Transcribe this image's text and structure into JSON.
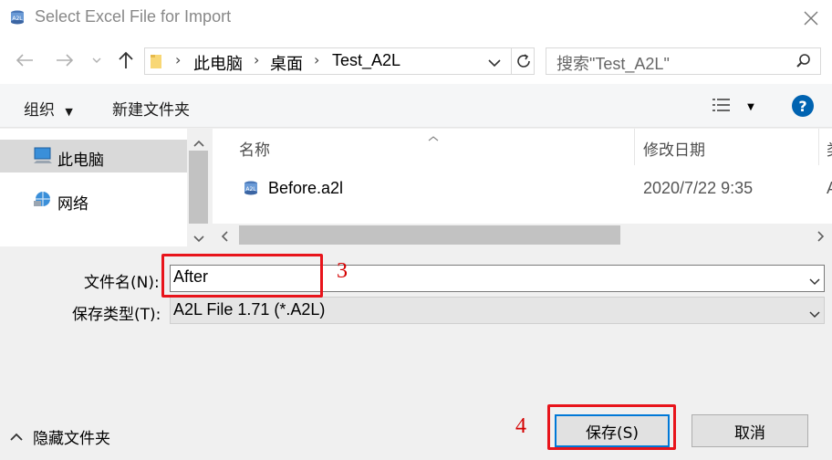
{
  "window": {
    "title": "Select Excel File for Import"
  },
  "address": {
    "crumbs": [
      "此电脑",
      "桌面",
      "Test_A2L"
    ],
    "search_placeholder": "搜索\"Test_A2L\""
  },
  "toolbar": {
    "organize": "组织",
    "new_folder": "新建文件夹"
  },
  "nav": {
    "items": [
      {
        "label": "此电脑"
      },
      {
        "label": "网络"
      }
    ]
  },
  "columns": {
    "name": "名称",
    "date": "修改日期",
    "extra": "类"
  },
  "files": [
    {
      "name": "Before.a2l",
      "date": "2020/7/22 9:35",
      "extra": "A"
    }
  ],
  "form": {
    "filename_label": "文件名(N):",
    "filename_value": "After",
    "filetype_label": "保存类型(T):",
    "filetype_value": "A2L File 1.71 (*.A2L)"
  },
  "buttons": {
    "save": "保存(S)",
    "cancel": "取消",
    "hide_folders": "隐藏文件夹"
  },
  "annotations": {
    "a3": "3",
    "a4": "4"
  },
  "colors": {
    "accent": "#0078d7",
    "annotation": "#e8141b",
    "help": "#0063b1"
  }
}
